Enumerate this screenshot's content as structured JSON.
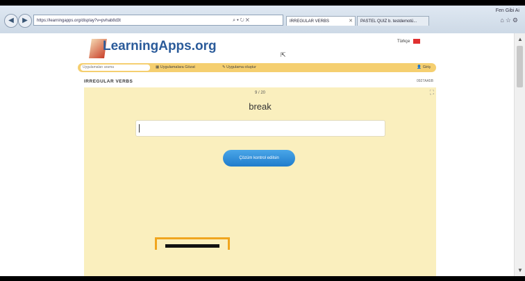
{
  "browser": {
    "address": "https://learningapps.org/display?v=pvhab8d3t",
    "tabs": [
      {
        "label": "IRREGULAR VERBS"
      },
      {
        "label": "PASTEL QUIZ b. testdemotü..."
      }
    ],
    "window_title": "Fen Gibi Ai"
  },
  "site": {
    "logo": "LearningApps.org",
    "language": "Türkçe"
  },
  "nav": {
    "search_placeholder": "Uygulamaları arama",
    "browse": "Uygulamalara Gözat",
    "create": "Uygulama oluştur",
    "login": "Giriş"
  },
  "app": {
    "title": "IRREGULAR VERBS",
    "meta": "0927AA5B",
    "counter": "9 / 20",
    "word": "break",
    "answer_value": "",
    "check_button": "Çözüm kontrol edilsin"
  }
}
